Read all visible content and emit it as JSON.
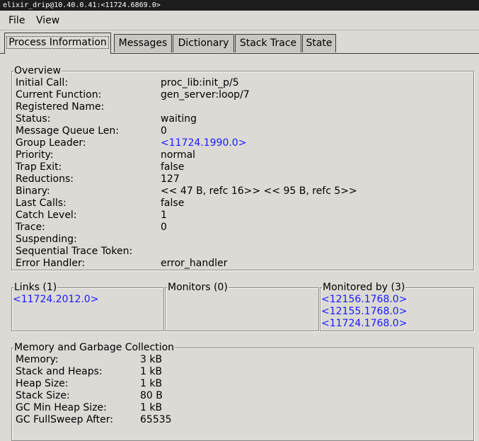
{
  "window": {
    "title": "elixir_drip@10.40.0.41:<11724.6869.0>"
  },
  "menu": {
    "file": "File",
    "view": "View"
  },
  "tabs": [
    "Process Information",
    "Messages",
    "Dictionary",
    "Stack Trace",
    "State"
  ],
  "overview": {
    "title": "Overview",
    "rows": [
      {
        "label": "Initial Call:",
        "value": "proc_lib:init_p/5"
      },
      {
        "label": "Current Function:",
        "value": "gen_server:loop/7"
      },
      {
        "label": "Registered Name:",
        "value": ""
      },
      {
        "label": "Status:",
        "value": "waiting"
      },
      {
        "label": "Message Queue Len:",
        "value": "0"
      },
      {
        "label": "Group Leader:",
        "value": "<11724.1990.0>"
      },
      {
        "label": "Priority:",
        "value": "normal"
      },
      {
        "label": "Trap Exit:",
        "value": "false"
      },
      {
        "label": "Reductions:",
        "value": "127"
      },
      {
        "label": "Binary:",
        "value": "<< 47 B, refc 16>> << 95 B, refc 5>>"
      },
      {
        "label": "Last Calls:",
        "value": "false"
      },
      {
        "label": "Catch Level:",
        "value": "1"
      },
      {
        "label": "Trace:",
        "value": "0"
      },
      {
        "label": "Suspending:",
        "value": ""
      },
      {
        "label": "Sequential Trace Token:",
        "value": ""
      },
      {
        "label": "Error Handler:",
        "value": "error_handler"
      }
    ]
  },
  "links": {
    "title": "Links (1)",
    "items": [
      "<11724.2012.0>"
    ]
  },
  "monitors": {
    "title": "Monitors (0)",
    "items": []
  },
  "monitored_by": {
    "title": "Monitored by (3)",
    "items": [
      "<12156.1768.0>",
      "<12155.1768.0>",
      "<11724.1768.0>"
    ]
  },
  "memory": {
    "title": "Memory and Garbage Collection",
    "rows": [
      {
        "label": "Memory:",
        "value": "3 kB"
      },
      {
        "label": "Stack and Heaps:",
        "value": "1 kB"
      },
      {
        "label": "Heap Size:",
        "value": "1 kB"
      },
      {
        "label": "Stack Size:",
        "value": "80 B"
      },
      {
        "label": "GC Min Heap Size:",
        "value": "1 kB"
      },
      {
        "label": "GC FullSweep After:",
        "value": "65535"
      }
    ]
  },
  "colors": {
    "link": "#1a1aff",
    "background": "#dcdad5",
    "titlebar": "#1d1d1d"
  }
}
